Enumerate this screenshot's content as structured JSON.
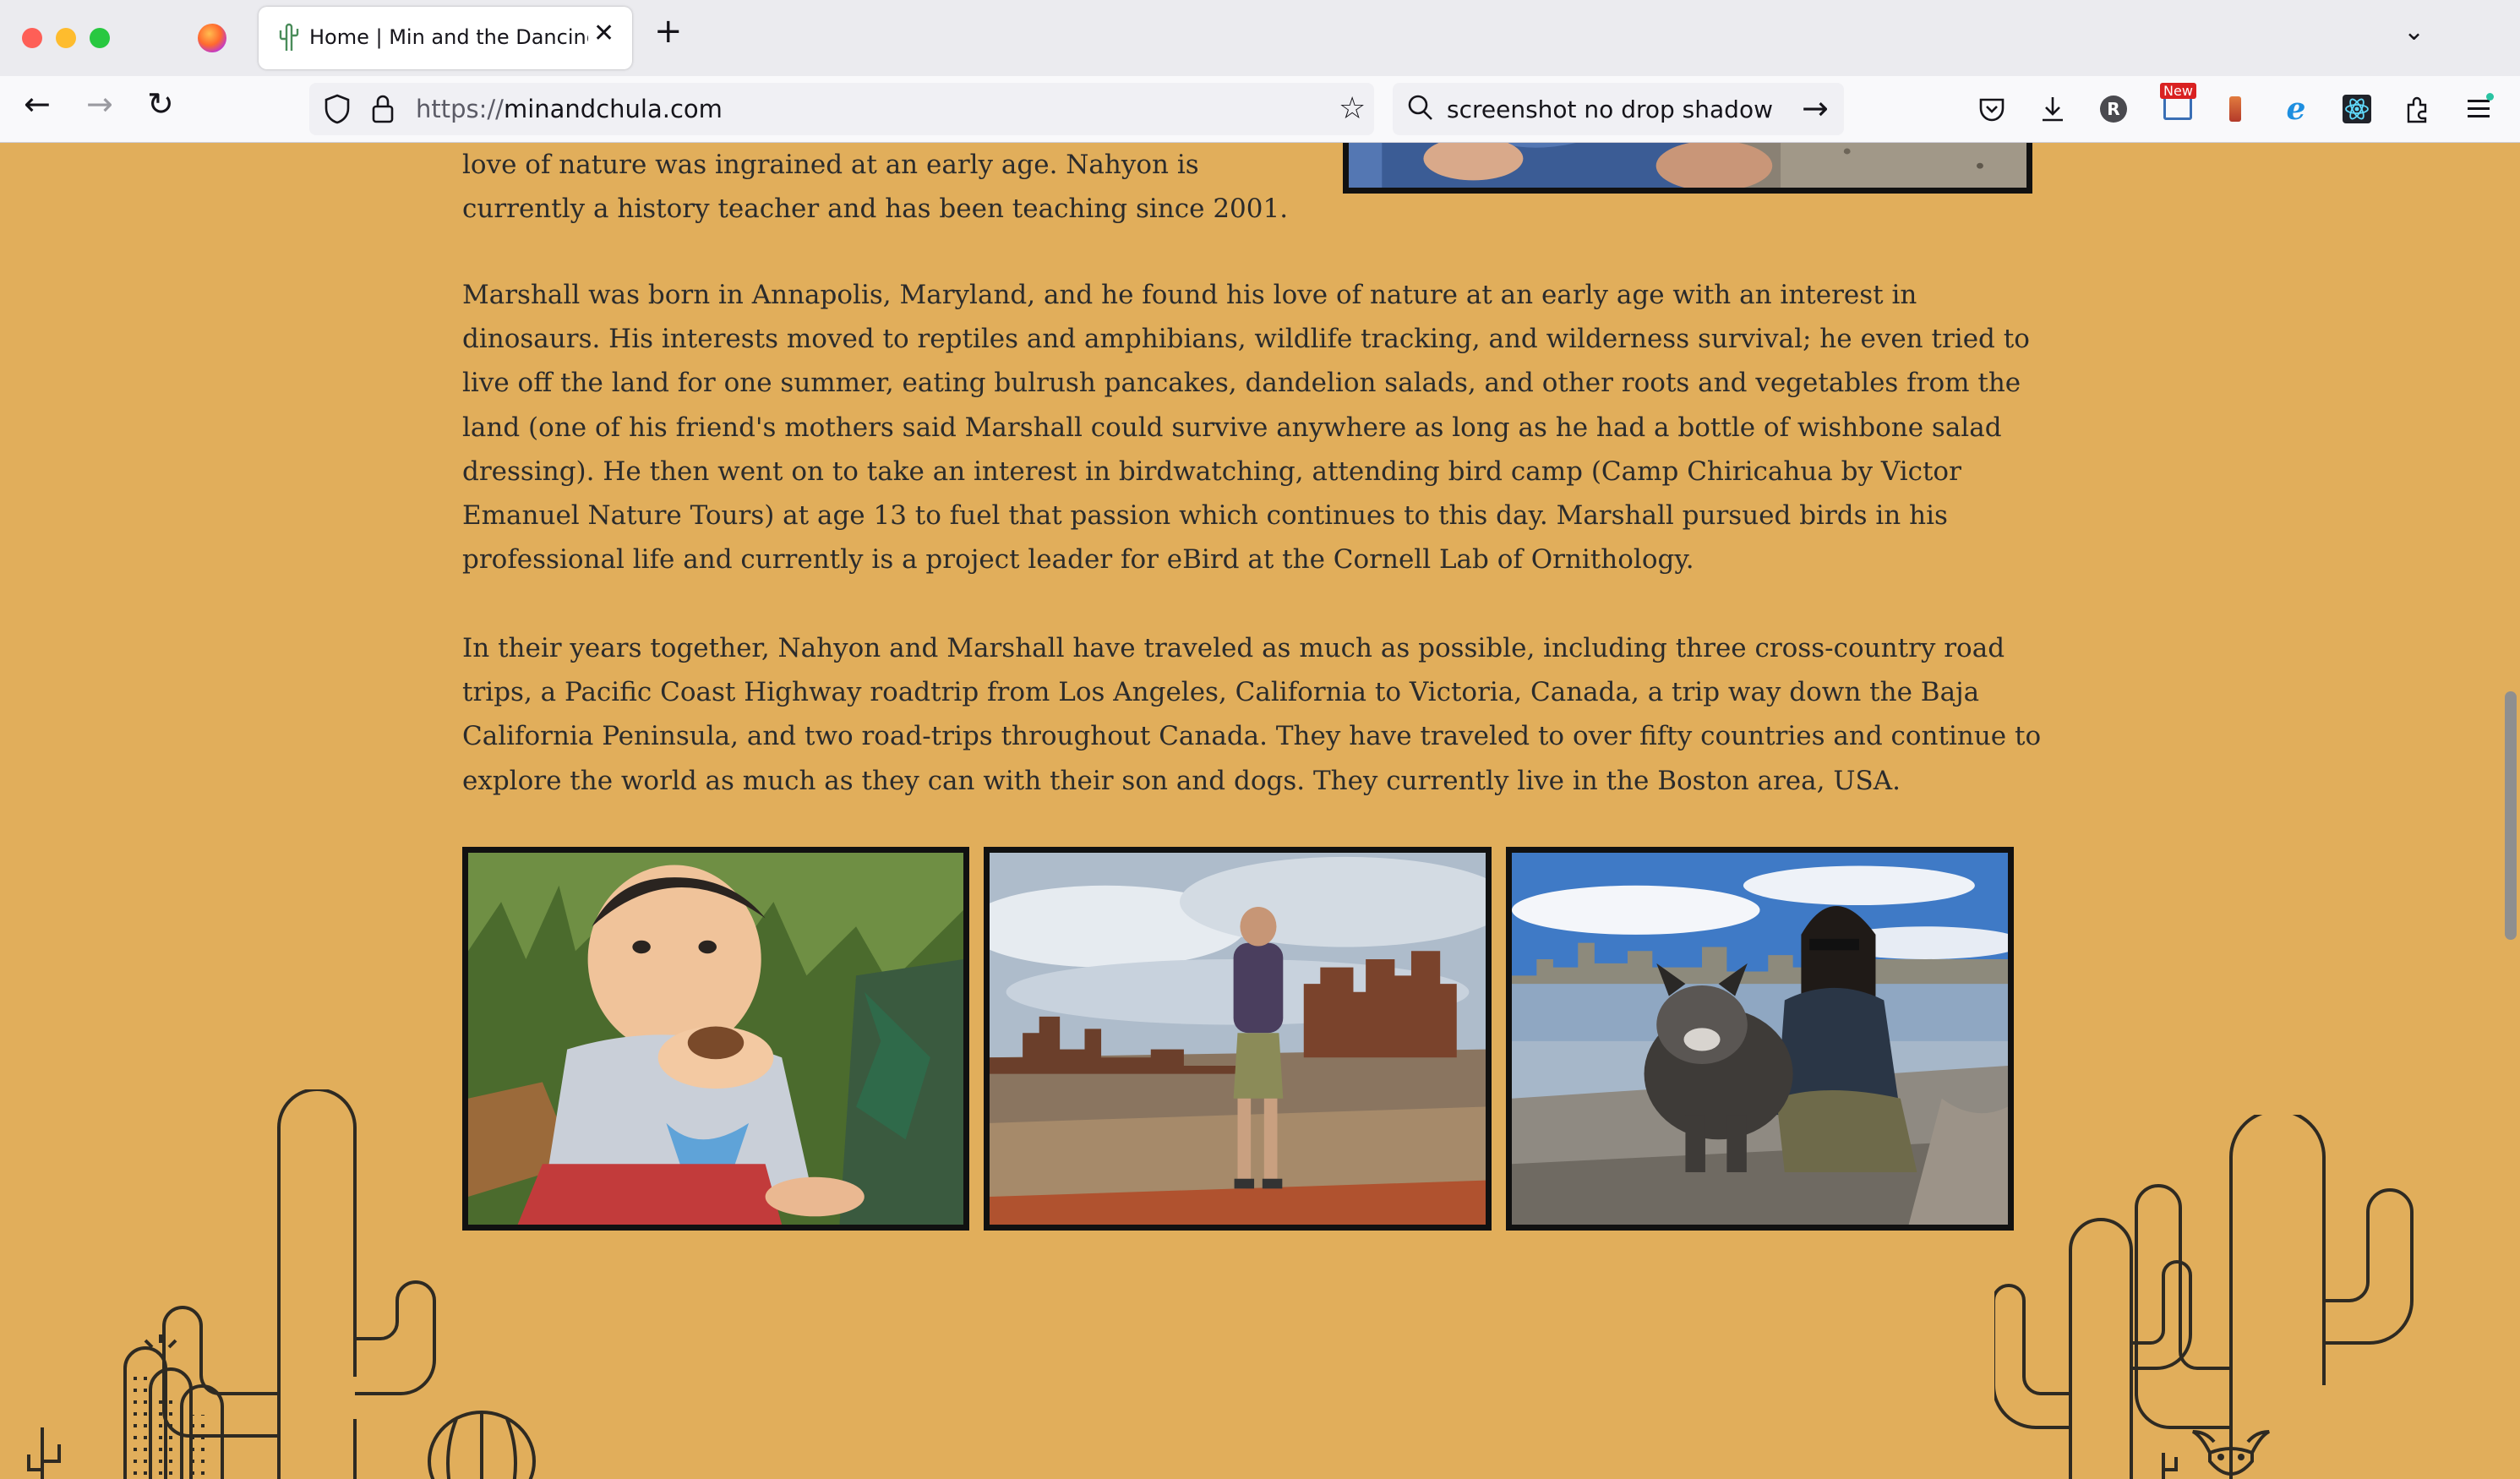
{
  "browser": {
    "tab": {
      "title": "Home | Min and the Dancing Ca"
    },
    "url": {
      "scheme": "https://",
      "host": "minandchula.com"
    },
    "search": {
      "query": "screenshot no drop shadow"
    },
    "toolbar": {
      "profile_letter": "R",
      "badge_label": "New"
    }
  },
  "page": {
    "paragraph_intro": "love of nature was ingrained at an early age. Nahyon is currently a history teacher and has been teaching since 2001.",
    "paragraph_marshall": "Marshall was born in Annapolis, Maryland, and he found his love of nature at an early age with an interest in dinosaurs. His interests moved to reptiles and amphibians, wildlife tracking, and wilderness survival; he even tried to live off the land for one summer, eating bulrush pancakes, dandelion salads, and other roots and vegetables from the land (one of his friend's mothers said Marshall could survive anywhere as long as he had a bottle of wishbone salad dressing). He then went on to take an interest in birdwatching, attending bird camp (Camp Chiricahua by Victor Emanuel Nature Tours) at age 13 to fuel that passion which continues to this day. Marshall pursued birds in his professional life and currently is a project leader for eBird at the Cornell Lab of Ornithology.",
    "paragraph_together": "In their years together, Nahyon and Marshall have traveled as much as possible, including three cross-country road trips, a Pacific Coast Highway roadtrip from Los Angeles, California to Victoria, Canada, a trip way down the Baja California Peninsula, and two road-trips throughout Canada. They have traveled to over fifty countries and continue to explore the world as much as they can with their son and dogs. They currently live in the Boston area, USA."
  },
  "colors": {
    "page_background": "#e1ae5b",
    "text": "#2b2b2b",
    "photo_border": "#111111",
    "cactus_line": "#2e2a22"
  },
  "photos": [
    "child-holding-shell-photo",
    "birdwatcher-canyon-photo",
    "woman-with-dog-lake-photo"
  ]
}
